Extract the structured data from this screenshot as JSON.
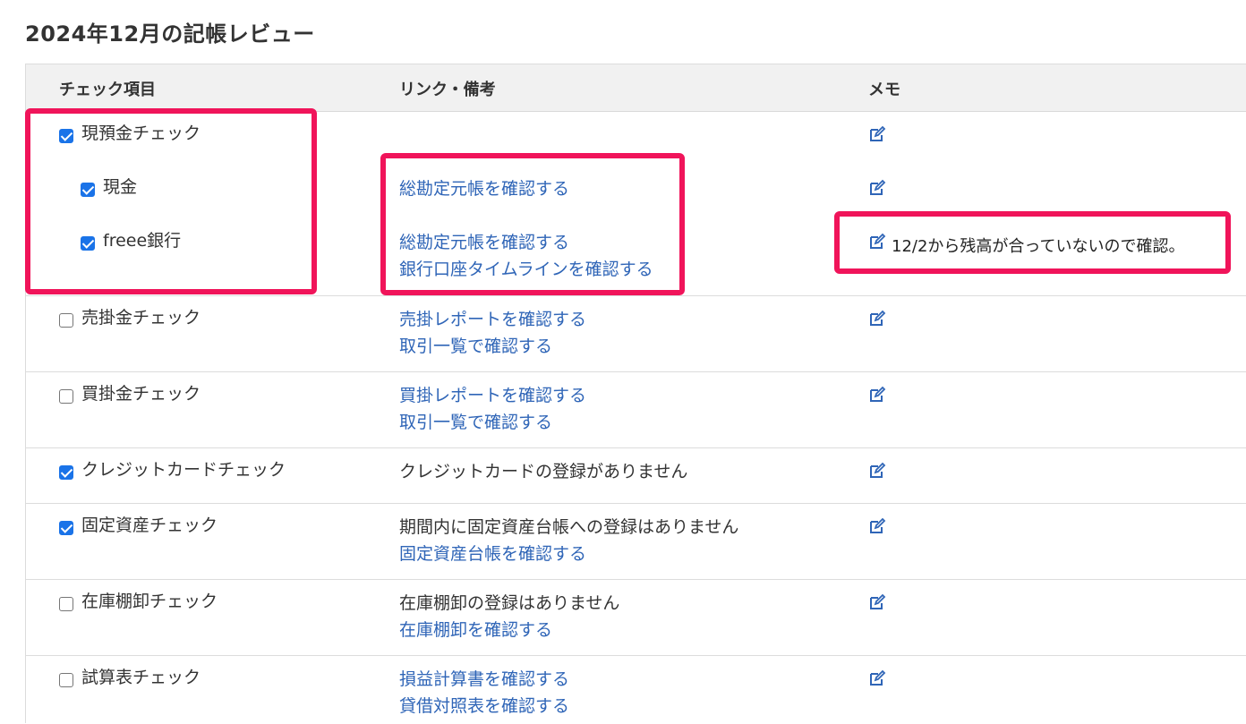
{
  "page_title": "2024年12月の記帳レビュー",
  "columns": {
    "check": "チェック項目",
    "links": "リンク・備考",
    "memo": "メモ"
  },
  "icons": {
    "memo": "edit-pencil-icon",
    "checked": "checkbox-checked",
    "unchecked": "checkbox-unchecked"
  },
  "colors": {
    "link": "#2f65b7",
    "highlight": "#f0145a",
    "checkbox": "#1a73e8"
  },
  "rows": [
    {
      "label": "現預金チェック",
      "checked": true
    },
    {
      "label": "現金",
      "checked": true,
      "links": [
        "総勘定元帳を確認する"
      ]
    },
    {
      "label": "freee銀行",
      "checked": true,
      "links": [
        "総勘定元帳を確認する",
        "銀行口座タイムラインを確認する"
      ],
      "memo": "12/2から残高が合っていないので確認。"
    },
    {
      "label": "売掛金チェック",
      "checked": false,
      "links": [
        "売掛レポートを確認する",
        "取引一覧で確認する"
      ]
    },
    {
      "label": "買掛金チェック",
      "checked": false,
      "links": [
        "買掛レポートを確認する",
        "取引一覧で確認する"
      ]
    },
    {
      "label": "クレジットカードチェック",
      "checked": true,
      "note": "クレジットカードの登録がありません"
    },
    {
      "label": "固定資産チェック",
      "checked": true,
      "note": "期間内に固定資産台帳への登録はありません",
      "links": [
        "固定資産台帳を確認する"
      ]
    },
    {
      "label": "在庫棚卸チェック",
      "checked": false,
      "note": "在庫棚卸の登録はありません",
      "links": [
        "在庫棚卸を確認する"
      ]
    },
    {
      "label": "試算表チェック",
      "checked": false,
      "links": [
        "損益計算書を確認する",
        "貸借対照表を確認する"
      ]
    }
  ]
}
